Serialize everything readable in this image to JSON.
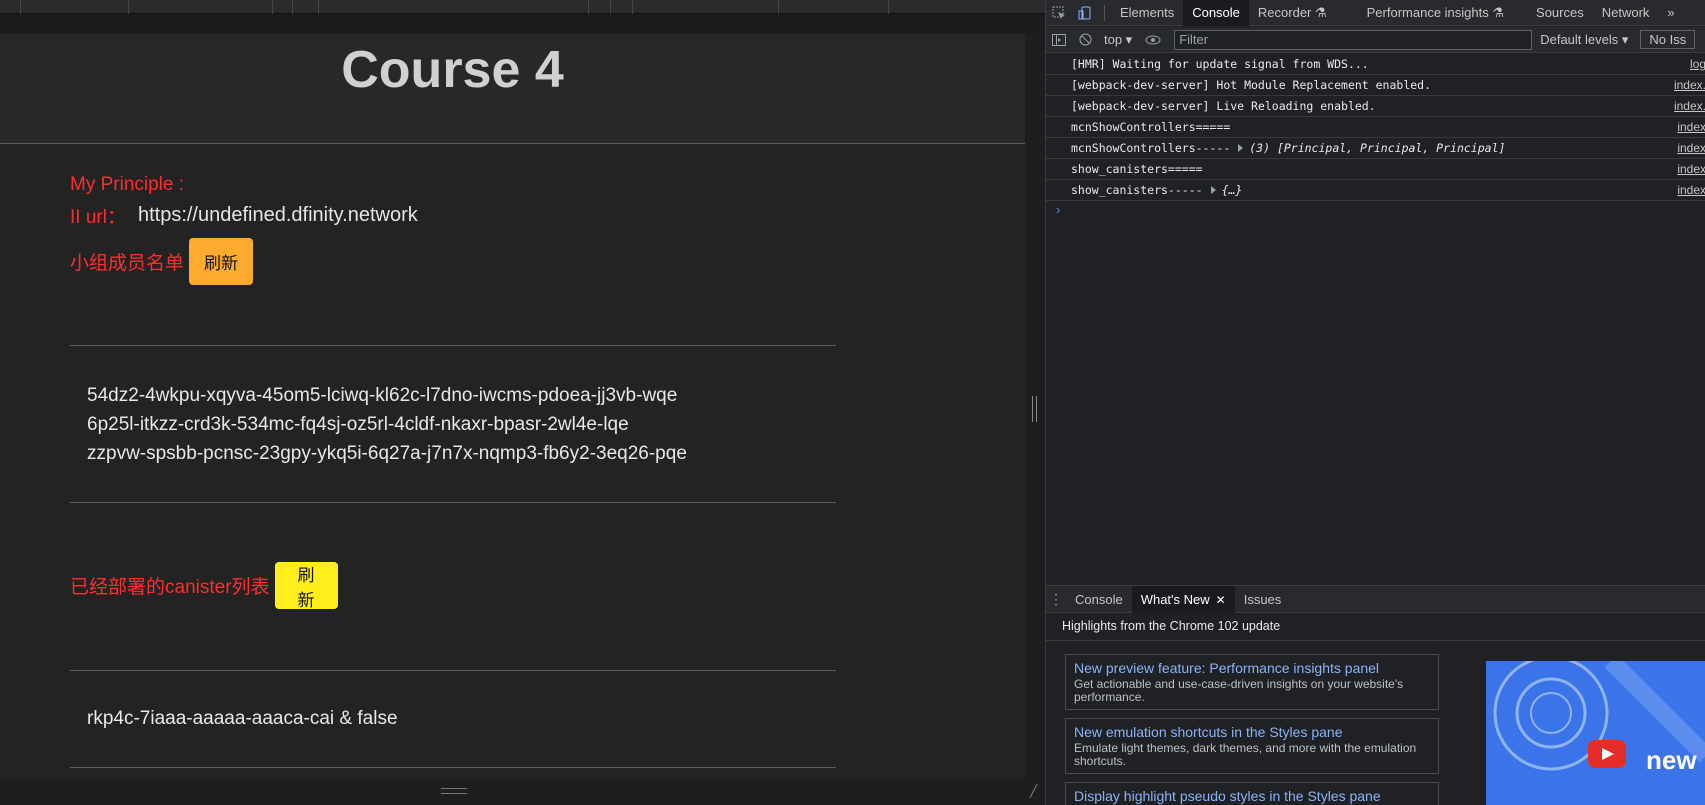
{
  "page": {
    "title": "Course 4",
    "principle_label": "My Principle :",
    "ii_url_label": "II url：",
    "ii_url_value": "https://undefined.dfinity.network",
    "members_label": "小组成员名单",
    "refresh_label": "刷新",
    "members": [
      "54dz2-4wkpu-xqyva-45om5-lciwq-kl62c-l7dno-iwcms-pdoea-jj3vb-wqe",
      "6p25l-itkzz-crd3k-534mc-fq4sj-oz5rl-4cldf-nkaxr-bpasr-2wl4e-lqe",
      "zzpvw-spsbb-pcnsc-23gpy-ykq5i-6q27a-j7n7x-nqmp3-fb6y2-3eq26-pqe"
    ],
    "canisters_label": "已经部署的canister列表",
    "canisters": [
      "rkp4c-7iaaa-aaaaa-aaaca-cai & false"
    ]
  },
  "devtools": {
    "tabs": [
      "Elements",
      "Console",
      "Recorder ⚗",
      "Performance insights ⚗",
      "Sources",
      "Network"
    ],
    "active_tab": "Console",
    "more_tabs": "»",
    "context": "top ▾",
    "filter_placeholder": "Filter",
    "levels": "Default levels ▾",
    "issues": "No Iss",
    "logs": [
      {
        "text": "[HMR] Waiting for update signal from WDS...",
        "obj": "",
        "src": "log"
      },
      {
        "text": "[webpack-dev-server] Hot Module Replacement enabled.",
        "obj": "",
        "src": "index."
      },
      {
        "text": "[webpack-dev-server] Live Reloading enabled.",
        "obj": "",
        "src": "index."
      },
      {
        "text": "mcnShowControllers=====",
        "obj": "",
        "src": "index"
      },
      {
        "text": "mcnShowControllers-----",
        "obj": "(3) [Principal, Principal, Principal]",
        "src": "index"
      },
      {
        "text": "show_canisters=====",
        "obj": "",
        "src": "index"
      },
      {
        "text": "show_canisters-----",
        "obj": "{…}",
        "src": "index"
      }
    ],
    "prompt": "›",
    "drawer_tabs": [
      "Console",
      "What's New",
      "Issues"
    ],
    "drawer_close": "✕",
    "whatsnew_title": "Highlights from the Chrome 102 update",
    "cards": [
      {
        "title": "New preview feature: Performance insights panel",
        "desc": "Get actionable and use-case-driven insights on your website's performance."
      },
      {
        "title": "New emulation shortcuts in the Styles pane",
        "desc": "Emulate light themes, dark themes, and more with the emulation shortcuts."
      },
      {
        "title": "Display highlight pseudo styles in the Styles pane",
        "desc": ""
      }
    ],
    "promo_text": "new",
    "icons": [
      "inspect-icon",
      "device-toggle-icon",
      "sidebar-icon",
      "clear-icon",
      "eye-icon",
      "more-vertical-icon",
      "youtube-play-icon"
    ]
  }
}
